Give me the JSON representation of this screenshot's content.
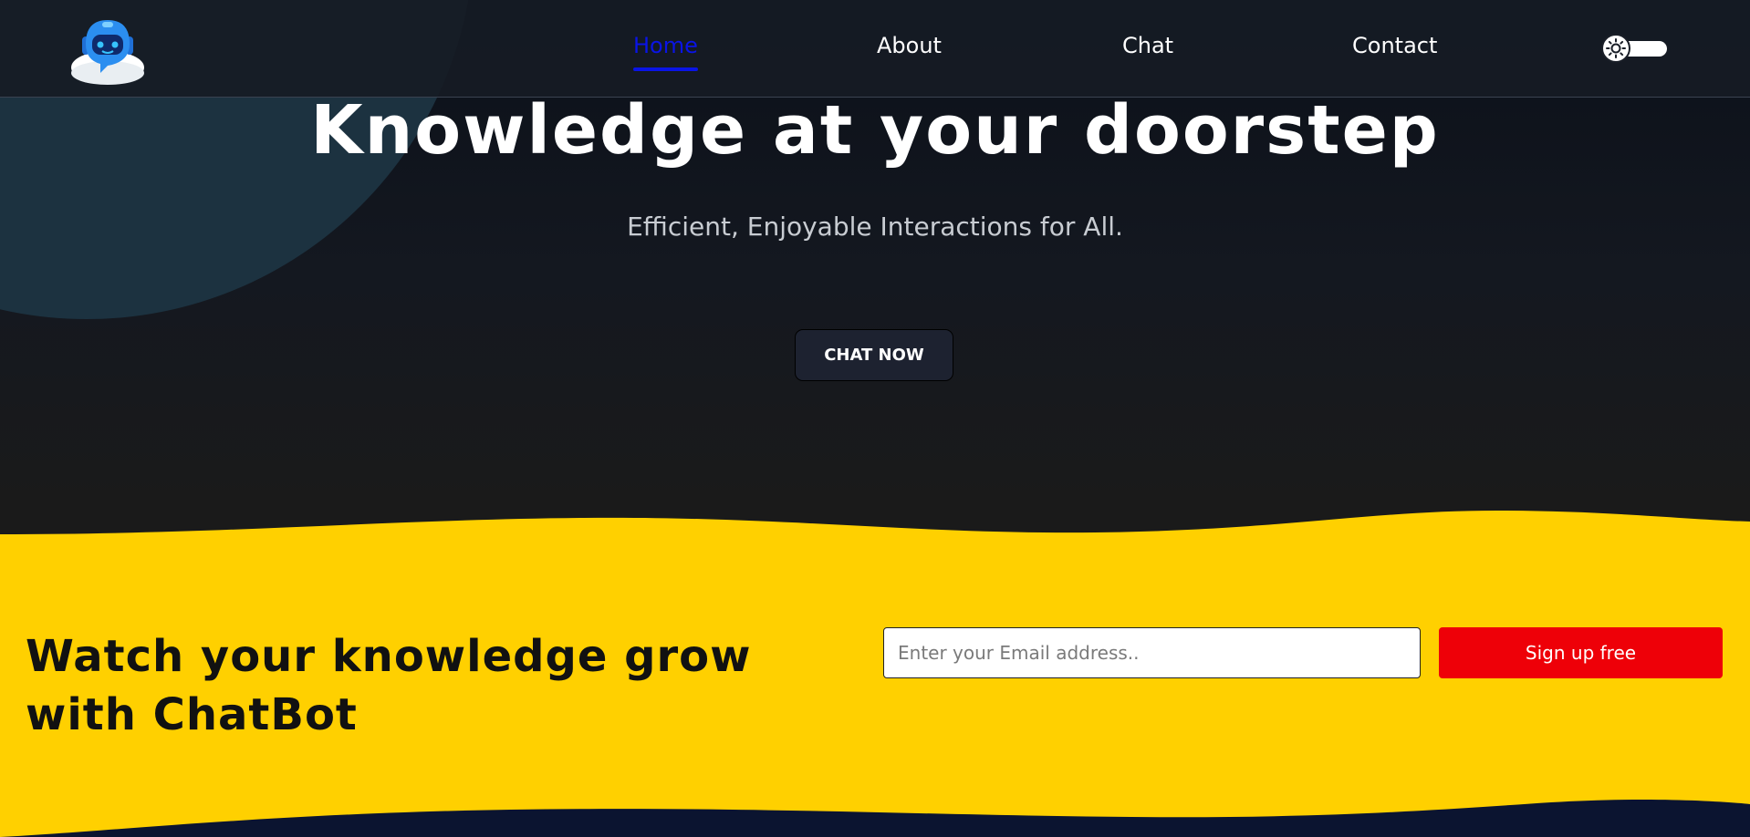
{
  "header": {
    "logo_icon": "chatbot-robot-icon",
    "nav": [
      {
        "label": "Home",
        "active": true
      },
      {
        "label": "About",
        "active": false
      },
      {
        "label": "Chat",
        "active": false
      },
      {
        "label": "Contact",
        "active": false
      }
    ],
    "theme_toggle_icon": "sun-icon"
  },
  "hero": {
    "title": "Knowledge at your doorstep",
    "subtitle": "Efficient, Enjoyable Interactions for All.",
    "cta_label": "CHAT NOW"
  },
  "signup": {
    "heading": "Watch your knowledge grow with ChatBot",
    "email_placeholder": "Enter your Email address..",
    "email_value": "",
    "button_label": "Sign up free"
  },
  "colors": {
    "accent_active": "#0a14e6",
    "signup_bg": "#ffd000",
    "signup_button": "#ee0008",
    "bg_dark": "#0c111a"
  }
}
